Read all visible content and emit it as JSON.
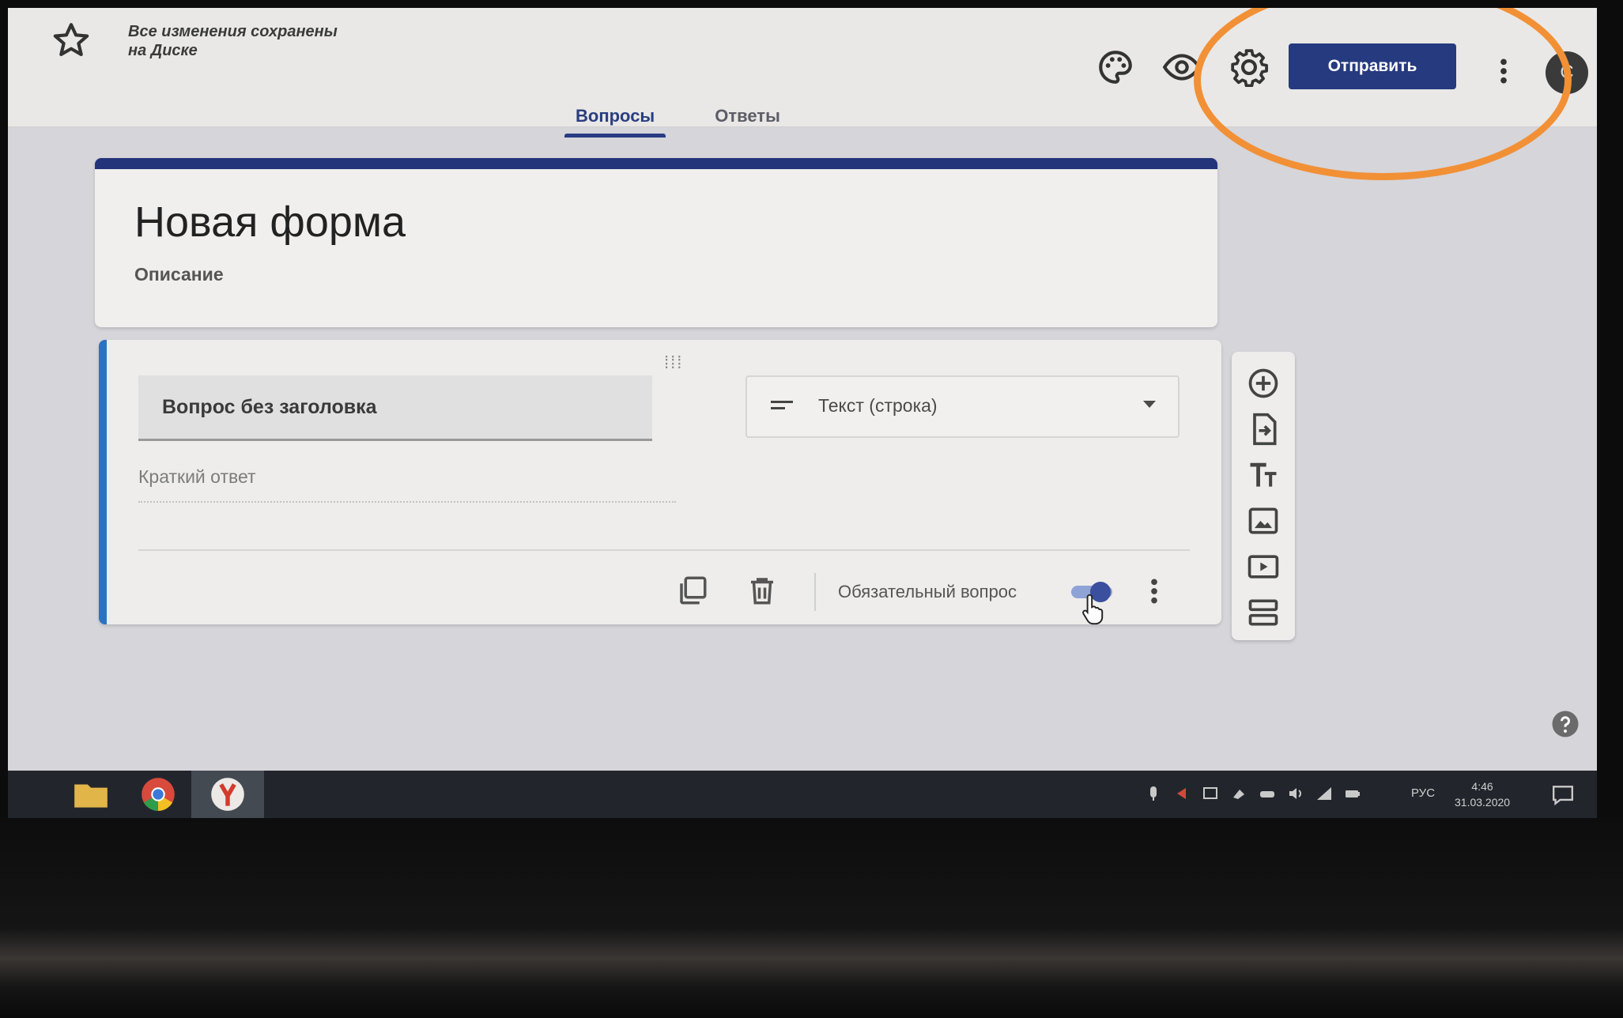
{
  "header": {
    "save_status_line1": "Все изменения сохранены",
    "save_status_line2": "на Диске",
    "send_label": "Отправить",
    "avatar_letter": "С"
  },
  "tabs": [
    {
      "label": "Вопросы",
      "active": true
    },
    {
      "label": "Ответы",
      "active": false
    }
  ],
  "form": {
    "title": "Новая форма",
    "description": "Описание"
  },
  "question": {
    "title": "Вопрос без заголовка",
    "type_label": "Текст (строка)",
    "answer_placeholder": "Краткий ответ",
    "required_label": "Обязательный вопрос",
    "required": true
  },
  "taskbar": {
    "language": "РУС",
    "time": "4:46",
    "date": "31.03.2020"
  },
  "colors": {
    "accent": "#263a7f",
    "annotation_circle": "#f29036",
    "question_accent": "#2a73c2"
  },
  "icons": {
    "header": [
      "star-icon",
      "palette-icon",
      "eye-icon",
      "gear-icon",
      "more-vert-icon"
    ],
    "side_toolbar": [
      "add-circle-icon",
      "import-icon",
      "title-icon",
      "image-icon",
      "video-icon",
      "section-icon"
    ]
  }
}
